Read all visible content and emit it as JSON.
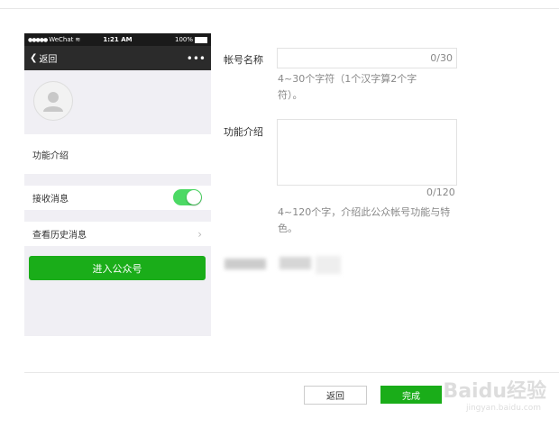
{
  "phone": {
    "status": {
      "carrier": "WeChat",
      "time": "1:21 AM",
      "battery": "100%"
    },
    "nav": {
      "back_label": "返回",
      "more_label": "•••"
    },
    "intro_label": "功能介绍",
    "receive_messages_label": "接收消息",
    "history_label": "查看历史消息",
    "enter_button": "进入公众号"
  },
  "form": {
    "account_name": {
      "label": "帐号名称",
      "value": "",
      "counter": "0/30",
      "hint": "4~30个字符（1个汉字算2个字符）。"
    },
    "function_intro": {
      "label": "功能介绍",
      "value": "",
      "counter": "0/120",
      "hint": "4~120个字，介绍此公众帐号功能与特色。"
    }
  },
  "footer": {
    "back_button": "返回",
    "done_button": "完成"
  },
  "watermark": {
    "text": "Baidu经验",
    "url": "jingyan.baidu.com"
  },
  "colors": {
    "accent_green": "#1aad19",
    "toggle_on": "#4cd964",
    "nav_dark": "#2b2b2b"
  }
}
